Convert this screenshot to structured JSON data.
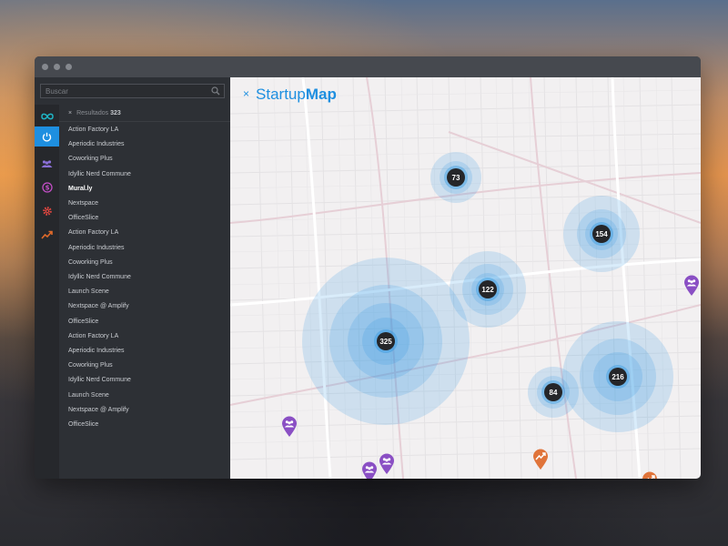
{
  "sidebar": {
    "search_placeholder": "Buscar",
    "results": {
      "close": "×",
      "label": "Resultados",
      "count": "323"
    },
    "rail": [
      {
        "icon": "infinity-icon",
        "active": false,
        "color": "#1fb6c6"
      },
      {
        "icon": "power-icon",
        "active": true,
        "color": "#ffffff"
      },
      {
        "icon": "people-icon",
        "active": false,
        "color": "#8a6fd6"
      },
      {
        "icon": "dollar-icon",
        "active": false,
        "color": "#c44fc8"
      },
      {
        "icon": "gear-icon",
        "active": false,
        "color": "#e0463f"
      },
      {
        "icon": "trend-icon",
        "active": false,
        "color": "#e06a2a"
      }
    ],
    "items": [
      "Action Factory LA",
      "Aperiodic Industries",
      "Coworking Plus",
      "Idyllic Nerd Commune",
      "Mural.ly",
      "Nextspace",
      "OfficeSlice",
      "Action Factory LA",
      "Aperiodic Industries",
      "Coworking Plus",
      "Idyllic Nerd Commune",
      "Launch Scene",
      "Nextspace @ Amplify",
      "OfficeSlice",
      "Action Factory LA",
      "Aperiodic Industries",
      "Coworking Plus",
      "Idyllic Nerd Commune",
      "Launch Scene",
      "Nextspace @ Amplify",
      "OfficeSlice"
    ],
    "selected_item": "Mural.ly"
  },
  "map": {
    "brand": {
      "close": "×",
      "light": "Startup",
      "bold": "Map"
    },
    "clusters": [
      "73",
      "154",
      "122",
      "325",
      "84",
      "216"
    ],
    "pins": [
      "people",
      "people",
      "people",
      "people",
      "trend",
      "trend",
      "trend"
    ],
    "colors": {
      "accent": "#1e8fe0",
      "people_pin": "#8a4fc4",
      "trend_pin": "#e0743a"
    }
  }
}
